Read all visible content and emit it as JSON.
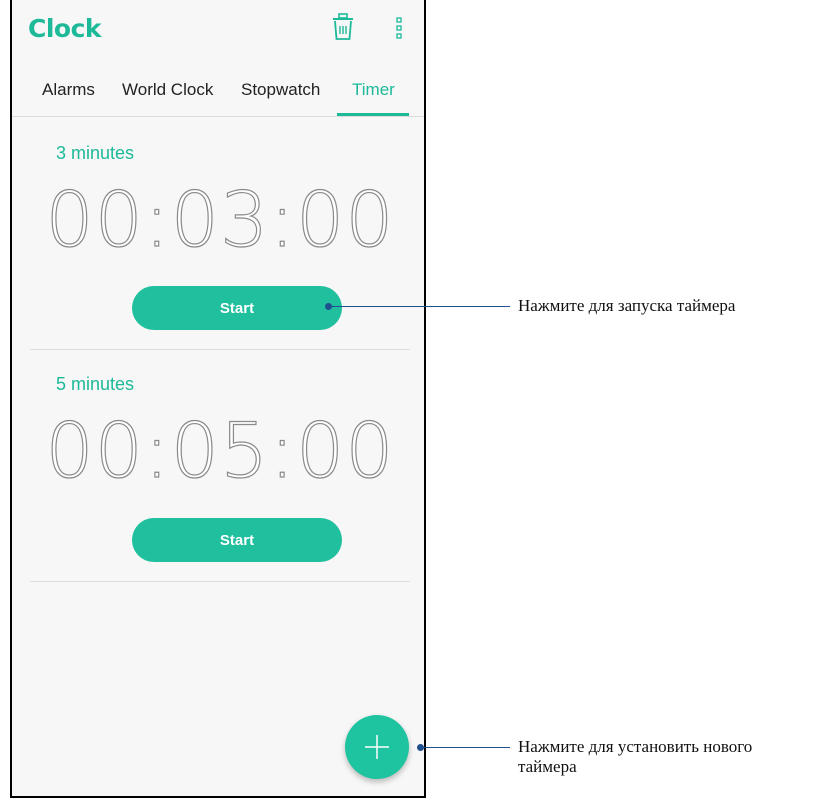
{
  "app": {
    "title": "Clock"
  },
  "icons": {
    "trash": "trash-icon",
    "more": "more-vertical-icon",
    "add": "plus-icon"
  },
  "tabs": [
    {
      "label": "Alarms",
      "active": false
    },
    {
      "label": "World Clock",
      "active": false
    },
    {
      "label": "Stopwatch",
      "active": false
    },
    {
      "label": "Timer",
      "active": true
    }
  ],
  "timers": [
    {
      "label": "3 minutes",
      "display": "00:03:00",
      "button": "Start"
    },
    {
      "label": "5 minutes",
      "display": "00:05:00",
      "button": "Start"
    }
  ],
  "annotations": {
    "start_hint": "Нажмите для запуска таймера",
    "add_hint_line1": "Нажмите для установить нового",
    "add_hint_line2": "таймера"
  },
  "colors": {
    "accent": "#1db999",
    "button": "#20bf9d",
    "callout": "#1f4f8f"
  }
}
